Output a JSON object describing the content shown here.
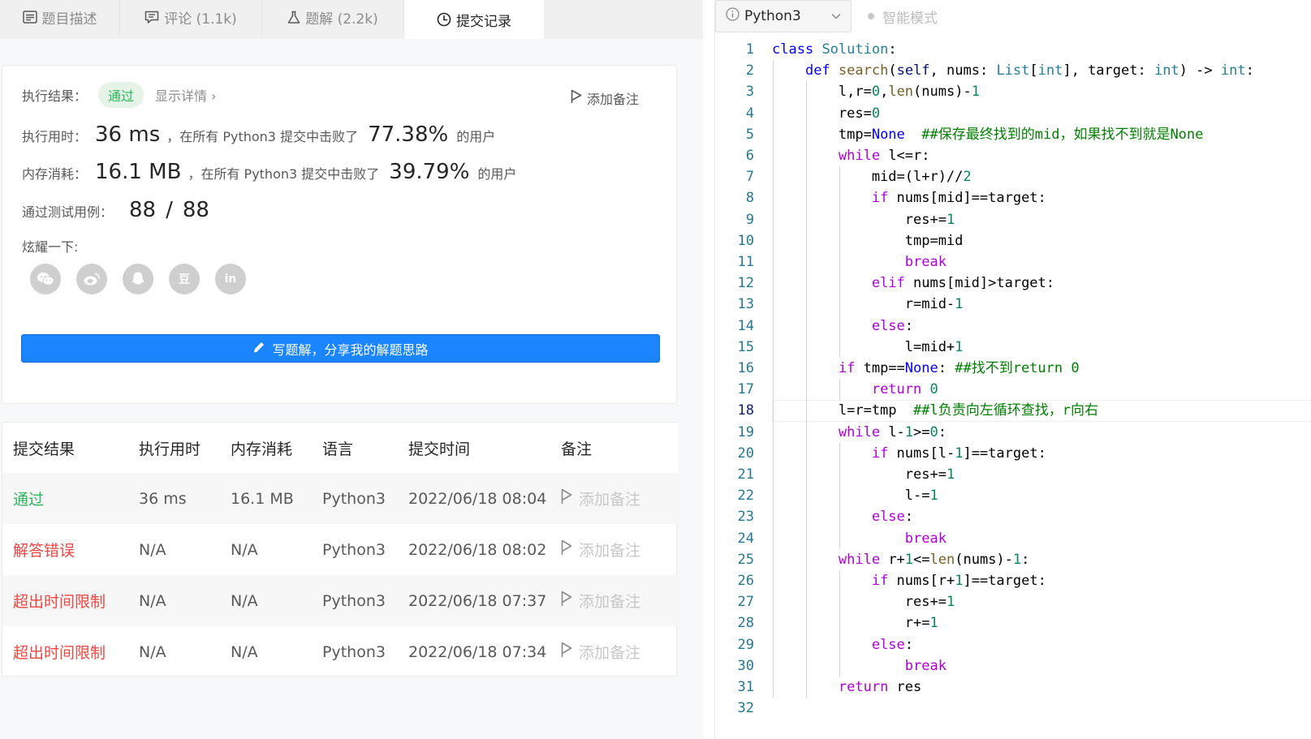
{
  "tabs": [
    {
      "label": "题目描述",
      "icon": "description-icon"
    },
    {
      "label": "评论 (1.1k)",
      "icon": "comment-icon"
    },
    {
      "label": "题解 (2.2k)",
      "icon": "flask-icon"
    },
    {
      "label": "提交记录",
      "icon": "clock-icon"
    }
  ],
  "result": {
    "status_label": "执行结果：",
    "status_value": "通过",
    "detail_link": "显示详情",
    "add_note": "添加备注",
    "runtime_label": "执行用时：",
    "runtime_value": "36 ms",
    "runtime_text": "，在所有 Python3 提交中击败了",
    "runtime_percent": "77.38%",
    "runtime_suffix": "的用户",
    "memory_label": "内存消耗：",
    "memory_value": "16.1 MB",
    "memory_text": "，在所有 Python3 提交中击败了",
    "memory_percent": "39.79%",
    "memory_suffix": "的用户",
    "tests_label": "通过测试用例：",
    "tests_passed": "88",
    "tests_sep": "/",
    "tests_total": "88",
    "share_label": "炫耀一下:",
    "share_icons": [
      "wechat-icon",
      "weibo-icon",
      "qq-icon",
      "douban-icon",
      "linkedin-icon"
    ],
    "douban_glyph": "豆",
    "linkedin_glyph": "in",
    "write_button": "写题解，分享我的解题思路"
  },
  "submissions": {
    "headers": [
      "提交结果",
      "执行用时",
      "内存消耗",
      "语言",
      "提交时间",
      "备注"
    ],
    "rows": [
      {
        "status": "通过",
        "status_color": "#2db55d",
        "runtime": "36 ms",
        "memory": "16.1 MB",
        "lang": "Python3",
        "time": "2022/06/18 08:04",
        "note": "添加备注"
      },
      {
        "status": "解答错误",
        "status_color": "#ef4743",
        "runtime": "N/A",
        "memory": "N/A",
        "lang": "Python3",
        "time": "2022/06/18 08:02",
        "note": "添加备注"
      },
      {
        "status": "超出时间限制",
        "status_color": "#ef4743",
        "runtime": "N/A",
        "memory": "N/A",
        "lang": "Python3",
        "time": "2022/06/18 07:37",
        "note": "添加备注"
      },
      {
        "status": "超出时间限制",
        "status_color": "#ef4743",
        "runtime": "N/A",
        "memory": "N/A",
        "lang": "Python3",
        "time": "2022/06/18 07:34",
        "note": "添加备注"
      }
    ]
  },
  "editor": {
    "language": "Python3",
    "smart_mode": "智能模式",
    "current_line": 18,
    "lines": [
      "class Solution:",
      "    def search(self, nums: List[int], target: int) -> int:",
      "        l,r=0,len(nums)-1",
      "        res=0",
      "        tmp=None  ##保存最终找到的mid，如果找不到就是None",
      "        while l<=r:",
      "            mid=(l+r)//2",
      "            if nums[mid]==target:",
      "                res+=1",
      "                tmp=mid",
      "                break",
      "            elif nums[mid]>target:",
      "                r=mid-1",
      "            else:",
      "                l=mid+1",
      "        if tmp==None: ##找不到return 0",
      "            return 0",
      "        l=r=tmp  ##l负责向左循环查找，r向右",
      "        while l-1>=0:",
      "            if nums[l-1]==target:",
      "                res+=1",
      "                l-=1",
      "            else:",
      "                break",
      "        while r+1<=len(nums)-1:",
      "            if nums[r+1]==target:",
      "                res+=1",
      "                r+=1",
      "            else:",
      "                break",
      "        return res",
      ""
    ]
  }
}
